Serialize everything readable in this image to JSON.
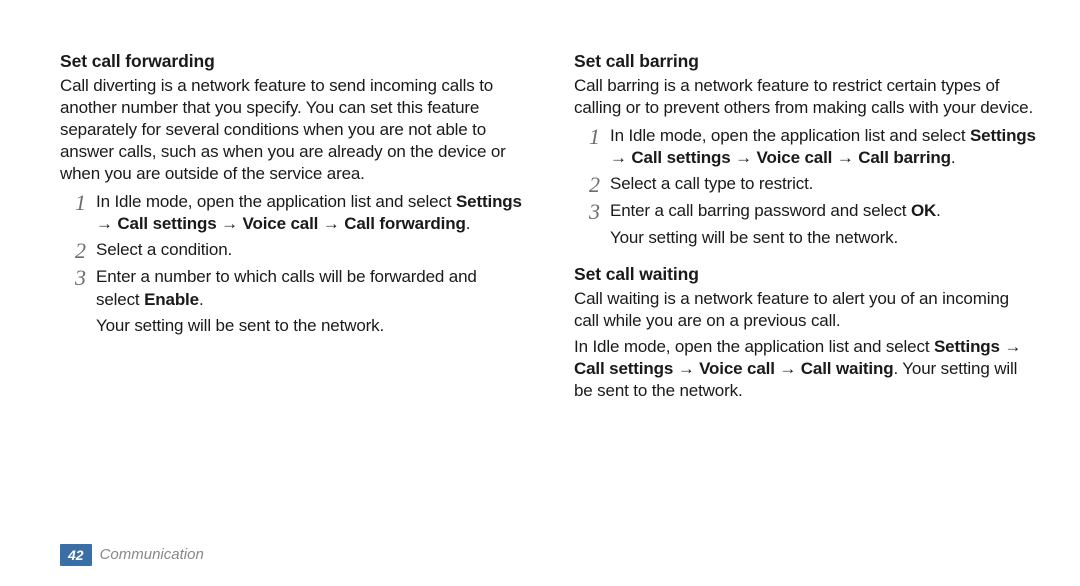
{
  "left": {
    "heading": "Set call forwarding",
    "intro": "Call diverting is a network feature to send incoming calls to another number that you specify. You can set this feature separately for several conditions when you are not able to answer calls, such as when you are already on the device or when you are outside of the service area.",
    "step1_a": "In Idle mode, open the application list and select ",
    "step1_b": "Settings → Call settings → Voice call → Call forwarding",
    "step1_c": ".",
    "step2": "Select a condition.",
    "step3_a": "Enter a number to which calls will be forwarded and select ",
    "step3_b": "Enable",
    "step3_c": ".",
    "after3": "Your setting will be sent to the network."
  },
  "right": {
    "heading1": "Set call barring",
    "intro1": "Call barring is a network feature to restrict certain types of calling or to prevent others from making calls with your device.",
    "r1_step1_a": "In Idle mode, open the application list and select ",
    "r1_step1_b": "Settings → Call settings → Voice call → Call barring",
    "r1_step1_c": ".",
    "r1_step2": "Select a call type to restrict.",
    "r1_step3_a": "Enter a call barring password and select ",
    "r1_step3_b": "OK",
    "r1_step3_c": ".",
    "r1_after3": "Your setting will be sent to the network.",
    "heading2": "Set call waiting",
    "intro2": "Call waiting is a network feature to alert you of an incoming call while you are on a previous call.",
    "para2_a": "In Idle mode, open the application list and select ",
    "para2_b": "Settings → Call settings → Voice call → Call waiting",
    "para2_c": ". Your setting will be sent to the network."
  },
  "footer": {
    "page": "42",
    "section": "Communication"
  },
  "nums": {
    "n1": "1",
    "n2": "2",
    "n3": "3"
  }
}
